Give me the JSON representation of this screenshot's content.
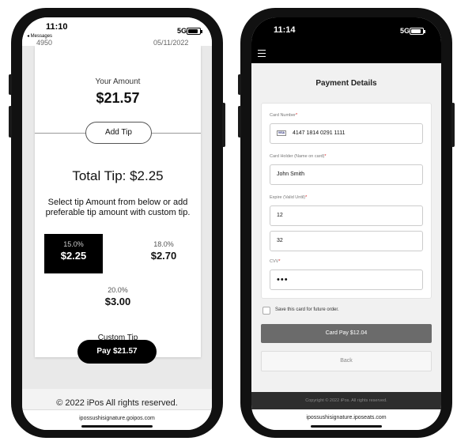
{
  "left_phone": {
    "status": {
      "time": "11:10",
      "back_label": "◂ Messages",
      "network": "5G"
    },
    "cropped_header": {
      "left": "4950",
      "right": "05/11/2022"
    },
    "amount": {
      "label": "Your Amount",
      "value": "$21.57"
    },
    "add_tip_label": "Add Tip",
    "total_tip": "Total Tip: $2.25",
    "tip_instructions": "Select tip Amount from below or add preferable tip amount with custom tip.",
    "tip_options": [
      {
        "percent": "15.0%",
        "amount": "$2.25",
        "selected": true
      },
      {
        "percent": "18.0%",
        "amount": "$2.70",
        "selected": false
      },
      {
        "percent": "20.0%",
        "amount": "$3.00",
        "selected": false
      }
    ],
    "custom_tip_label": "Custom Tip",
    "pay_button": "Pay $21.57",
    "footer": "© 2022 iPos All rights reserved.",
    "url": "ipossushisignature.goipos.com"
  },
  "right_phone": {
    "status": {
      "time": "11:14",
      "network": "5G"
    },
    "title": "Payment Details",
    "form": {
      "card_number": {
        "label": "Card Number",
        "value": "4147 1814 0291 1111",
        "brand": "VISA"
      },
      "holder": {
        "label": "Card Holder (Name on card)",
        "value": "John Smith"
      },
      "expire": {
        "label": "Expire (Valid Until)",
        "month": "12",
        "year": "32"
      },
      "cvv": {
        "label": "CVV",
        "value": "•••"
      }
    },
    "required_mark": "*",
    "save_label": "Save this card for future order.",
    "pay_button": "Card Pay $12.04",
    "back_button": "Back",
    "footer": "Copyright © 2022 iPos. All rights reserved.",
    "url": "ipossushisignature.iposeats.com"
  }
}
